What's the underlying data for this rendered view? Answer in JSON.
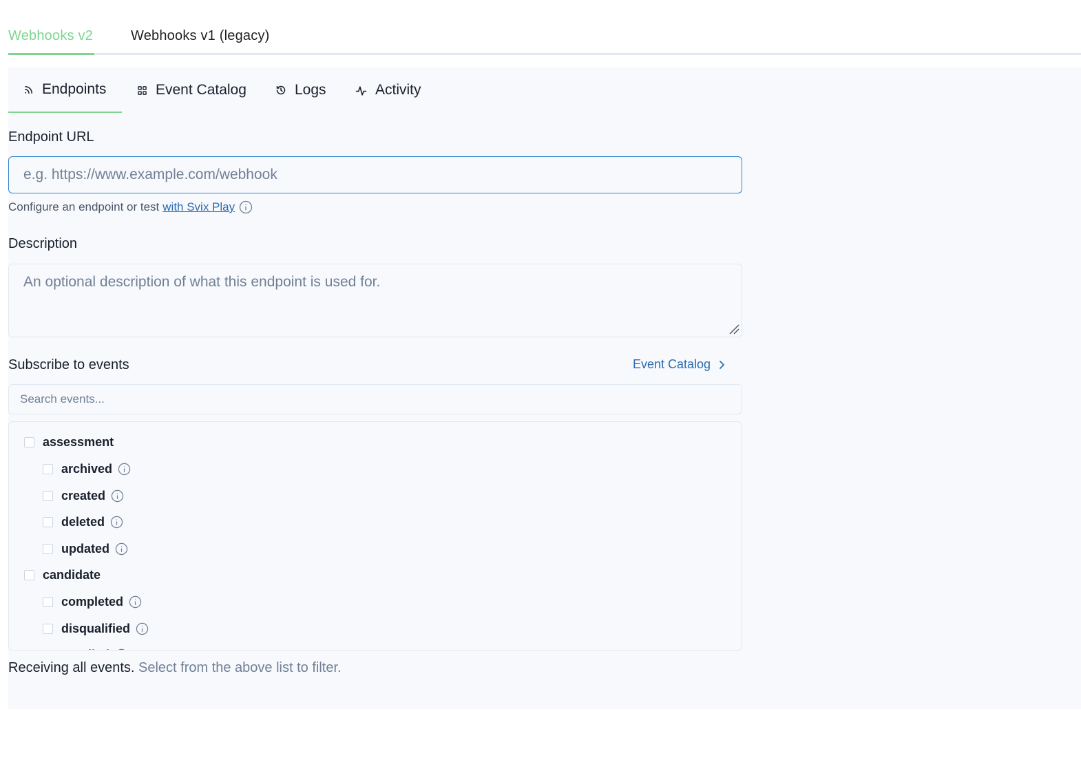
{
  "top_tabs": {
    "v2": "Webhooks v2",
    "v1": "Webhooks v1 (legacy)"
  },
  "sub_tabs": {
    "endpoints": "Endpoints",
    "event_catalog": "Event Catalog",
    "logs": "Logs",
    "activity": "Activity"
  },
  "form": {
    "url_label": "Endpoint URL",
    "url_placeholder": "e.g. https://www.example.com/webhook",
    "help_text": "Configure an endpoint or test",
    "help_link": "with Svix Play",
    "description_label": "Description",
    "description_placeholder": "An optional description of what this endpoint is used for.",
    "subscribe_label": "Subscribe to events",
    "catalog_link": "Event Catalog",
    "search_placeholder": "Search events..."
  },
  "events": {
    "groups": [
      {
        "name": "assessment",
        "children": [
          "archived",
          "created",
          "deleted",
          "updated"
        ]
      },
      {
        "name": "candidate",
        "children": [
          "completed",
          "disqualified",
          "enrolled"
        ]
      }
    ]
  },
  "footer": {
    "strong": "Receiving all events.",
    "muted": "Select from the above list to filter."
  },
  "colors": {
    "accent_green": "#7dd58f",
    "link_blue": "#2b6cb0",
    "focus_blue": "#3182ce",
    "panel_bg": "#f7f9fc"
  }
}
